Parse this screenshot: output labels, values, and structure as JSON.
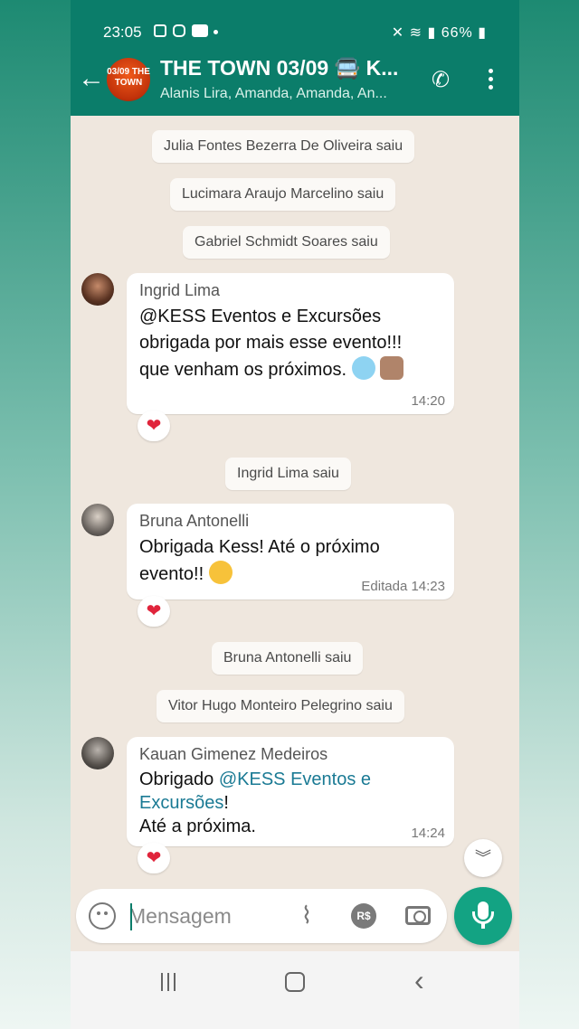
{
  "status_bar": {
    "time": "23:05",
    "battery": "66%"
  },
  "header": {
    "back_icon": "arrow-left-icon",
    "group_avatar_text": "03/09 THE TOWN",
    "title": "THE TOWN 03/09 🚍 K...",
    "subtitle": "Alanis Lira, Amanda, Amanda, An...",
    "call_icon": "call-add-icon",
    "menu_icon": "more-vert-icon",
    "accent_color": "#0b7d6a"
  },
  "system_messages": [
    "Julia Fontes Bezerra De Oliveira saiu",
    "Lucimara Araujo Marcelino saiu",
    "Gabriel Schmidt Soares saiu",
    "Ingrid Lima saiu",
    "Bruna Antonelli saiu",
    "Vitor Hugo Monteiro Pelegrino saiu"
  ],
  "messages": [
    {
      "sender": "Ingrid Lima",
      "mention": "@KESS Eventos e Excursões",
      "line1": "obrigada por mais esse evento!!!",
      "line2": "que venham os próximos.",
      "time": "14:20",
      "reaction": "❤"
    },
    {
      "sender": "Bruna Antonelli",
      "line1": "Obrigada Kess! Até o próximo",
      "line2": "evento!!",
      "edited": "Editada",
      "time": "14:23",
      "reaction": "❤"
    },
    {
      "sender": "Kauan Gimenez Medeiros",
      "prefix": "Obrigado",
      "mention1": "@KESS Eventos e",
      "mention2": "Excursões",
      "suffix": "!",
      "line3": "Até a próxima.",
      "time": "14:24",
      "reaction": "❤"
    }
  ],
  "composer": {
    "placeholder": "Mensagem",
    "pay_label": "R$"
  },
  "scroll_down_icon": "double-chevron-down-icon"
}
